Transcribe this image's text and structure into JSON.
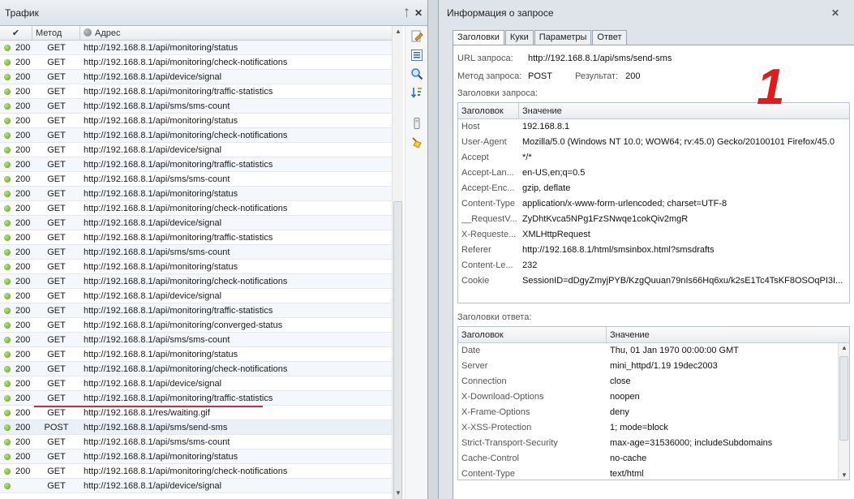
{
  "left_pane": {
    "title": "Трафик",
    "pin": "ᛏ",
    "close": "✕",
    "columns": {
      "check": "✔",
      "method": "Метод",
      "address": "Адрес"
    }
  },
  "traffic_rows": [
    {
      "status": "200",
      "method": "GET",
      "url": "http://192.168.8.1/api/monitoring/status"
    },
    {
      "status": "200",
      "method": "GET",
      "url": "http://192.168.8.1/api/monitoring/check-notifications"
    },
    {
      "status": "200",
      "method": "GET",
      "url": "http://192.168.8.1/api/device/signal"
    },
    {
      "status": "200",
      "method": "GET",
      "url": "http://192.168.8.1/api/monitoring/traffic-statistics"
    },
    {
      "status": "200",
      "method": "GET",
      "url": "http://192.168.8.1/api/sms/sms-count"
    },
    {
      "status": "200",
      "method": "GET",
      "url": "http://192.168.8.1/api/monitoring/status"
    },
    {
      "status": "200",
      "method": "GET",
      "url": "http://192.168.8.1/api/monitoring/check-notifications"
    },
    {
      "status": "200",
      "method": "GET",
      "url": "http://192.168.8.1/api/device/signal"
    },
    {
      "status": "200",
      "method": "GET",
      "url": "http://192.168.8.1/api/monitoring/traffic-statistics"
    },
    {
      "status": "200",
      "method": "GET",
      "url": "http://192.168.8.1/api/sms/sms-count"
    },
    {
      "status": "200",
      "method": "GET",
      "url": "http://192.168.8.1/api/monitoring/status"
    },
    {
      "status": "200",
      "method": "GET",
      "url": "http://192.168.8.1/api/monitoring/check-notifications"
    },
    {
      "status": "200",
      "method": "GET",
      "url": "http://192.168.8.1/api/device/signal"
    },
    {
      "status": "200",
      "method": "GET",
      "url": "http://192.168.8.1/api/monitoring/traffic-statistics"
    },
    {
      "status": "200",
      "method": "GET",
      "url": "http://192.168.8.1/api/sms/sms-count"
    },
    {
      "status": "200",
      "method": "GET",
      "url": "http://192.168.8.1/api/monitoring/status"
    },
    {
      "status": "200",
      "method": "GET",
      "url": "http://192.168.8.1/api/monitoring/check-notifications"
    },
    {
      "status": "200",
      "method": "GET",
      "url": "http://192.168.8.1/api/device/signal"
    },
    {
      "status": "200",
      "method": "GET",
      "url": "http://192.168.8.1/api/monitoring/traffic-statistics"
    },
    {
      "status": "200",
      "method": "GET",
      "url": "http://192.168.8.1/api/monitoring/converged-status"
    },
    {
      "status": "200",
      "method": "GET",
      "url": "http://192.168.8.1/api/sms/sms-count"
    },
    {
      "status": "200",
      "method": "GET",
      "url": "http://192.168.8.1/api/monitoring/status"
    },
    {
      "status": "200",
      "method": "GET",
      "url": "http://192.168.8.1/api/monitoring/check-notifications"
    },
    {
      "status": "200",
      "method": "GET",
      "url": "http://192.168.8.1/api/device/signal"
    },
    {
      "status": "200",
      "method": "GET",
      "url": "http://192.168.8.1/api/monitoring/traffic-statistics"
    },
    {
      "status": "200",
      "method": "GET",
      "url": "http://192.168.8.1/res/waiting.gif"
    },
    {
      "status": "200",
      "method": "POST",
      "url": "http://192.168.8.1/api/sms/send-sms",
      "selected": true
    },
    {
      "status": "200",
      "method": "GET",
      "url": "http://192.168.8.1/api/sms/sms-count"
    },
    {
      "status": "200",
      "method": "GET",
      "url": "http://192.168.8.1/api/monitoring/status"
    },
    {
      "status": "200",
      "method": "GET",
      "url": "http://192.168.8.1/api/monitoring/check-notifications"
    },
    {
      "status": "",
      "method": "GET",
      "url": "http://192.168.8.1/api/device/signal"
    }
  ],
  "toolbar_icons": [
    "edit-icon",
    "list-icon",
    "search-icon",
    "sort-icon",
    "device-icon",
    "clear-icon"
  ],
  "right_pane": {
    "title": "Информация о запросе",
    "close": "✕",
    "tabs": [
      "Заголовки",
      "Куки",
      "Параметры",
      "Ответ"
    ],
    "url_label": "URL запроса:",
    "url_value": "http://192.168.8.1/api/sms/send-sms",
    "method_label": "Метод запроса:",
    "method_value": "POST",
    "result_label": "Результат:",
    "result_value": "200",
    "big_number": "1",
    "request_headers_title": "Заголовки запроса:",
    "response_headers_title": "Заголовки ответа:",
    "col_header": "Заголовок",
    "col_value": "Значение"
  },
  "request_headers": [
    {
      "k": "Host",
      "v": "192.168.8.1"
    },
    {
      "k": "User-Agent",
      "v": "Mozilla/5.0 (Windows NT 10.0; WOW64; rv:45.0) Gecko/20100101 Firefox/45.0"
    },
    {
      "k": "Accept",
      "v": "*/*"
    },
    {
      "k": "Accept-Lan...",
      "v": "en-US,en;q=0.5"
    },
    {
      "k": "Accept-Enc...",
      "v": "gzip, deflate"
    },
    {
      "k": "Content-Type",
      "v": "application/x-www-form-urlencoded; charset=UTF-8"
    },
    {
      "k": "__RequestV...",
      "v": "ZyDhtKvca5NPg1FzSNwqe1cokQiv2mgR"
    },
    {
      "k": "X-Requeste...",
      "v": "XMLHttpRequest"
    },
    {
      "k": "Referer",
      "v": "http://192.168.8.1/html/smsinbox.html?smsdrafts"
    },
    {
      "k": "Content-Le...",
      "v": "232"
    },
    {
      "k": "Cookie",
      "v": "SessionID=dDgyZmyjPYB/KzgQuuan79nIs66Hq6xu/k2sE1Tc4TsKF8OSOqPI3I..."
    }
  ],
  "response_headers": [
    {
      "k": "Date",
      "v": "Thu, 01 Jan 1970 00:00:00 GMT"
    },
    {
      "k": "Server",
      "v": "mini_httpd/1.19 19dec2003"
    },
    {
      "k": "Connection",
      "v": "close"
    },
    {
      "k": "X-Download-Options",
      "v": "noopen"
    },
    {
      "k": "X-Frame-Options",
      "v": "deny"
    },
    {
      "k": "X-XSS-Protection",
      "v": "1; mode=block"
    },
    {
      "k": "Strict-Transport-Security",
      "v": "max-age=31536000; includeSubdomains"
    },
    {
      "k": "Cache-Control",
      "v": "no-cache"
    },
    {
      "k": "Content-Type",
      "v": "text/html"
    }
  ],
  "colors": {
    "accent_red": "#e11a1a",
    "status_green": "#5ba112"
  }
}
